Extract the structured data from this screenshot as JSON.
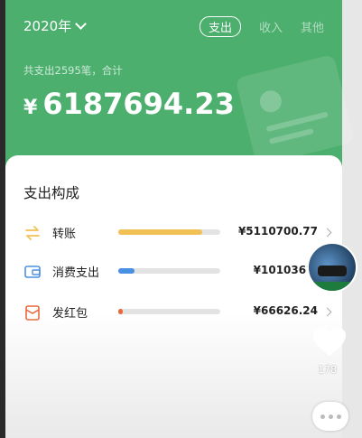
{
  "header": {
    "year": "2020年",
    "tabs": [
      {
        "label": "支出",
        "active": true
      },
      {
        "label": "收入",
        "active": false
      },
      {
        "label": "其他",
        "active": false
      }
    ],
    "summary": "共支出2595笔，合计",
    "currency": "¥",
    "amount": "6187694.23"
  },
  "breakdown": {
    "title": "支出构成",
    "items": [
      {
        "label": "转账",
        "icon": "transfer-icon",
        "color": "#f2c156",
        "ratio": 0.826,
        "value": "¥5110700.77"
      },
      {
        "label": "消费支出",
        "icon": "wallet-icon",
        "color": "#4a90e2",
        "ratio": 0.163,
        "value": "¥1010367."
      },
      {
        "label": "发红包",
        "icon": "red-packet-icon",
        "color": "#e8673a",
        "ratio": 0.011,
        "value": "¥66626.24"
      }
    ]
  },
  "overlay": {
    "like_count": "178"
  },
  "colors": {
    "header_green": "#4caf6e",
    "card_bg": "#ffffff"
  }
}
